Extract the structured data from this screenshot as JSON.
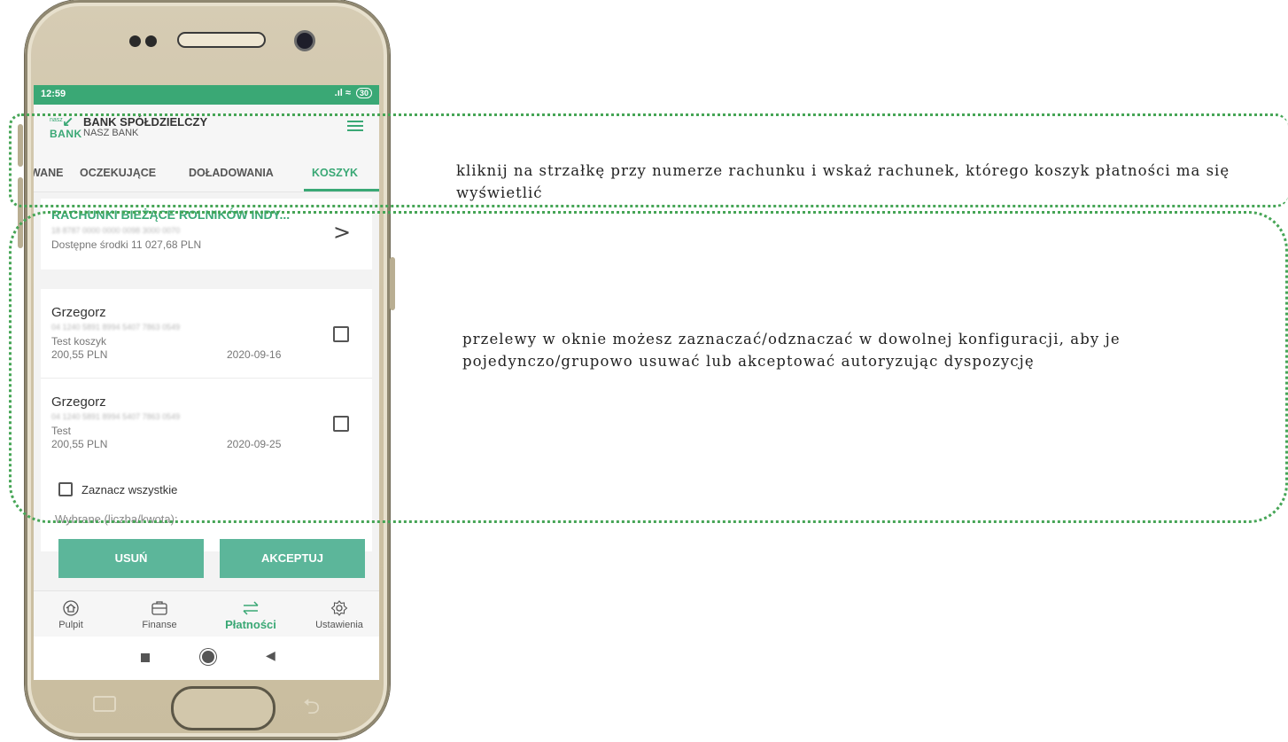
{
  "status_bar": {
    "time": "12:59",
    "battery": "30"
  },
  "header": {
    "logo_small": "nasz",
    "logo_text": "BANK",
    "bank_name": "BANK SPÓŁDZIELCZY",
    "bank_sub": "NASZ BANK"
  },
  "tabs": [
    {
      "label": "WANE"
    },
    {
      "label": "OCZEKUJĄCE"
    },
    {
      "label": "DOŁADOWANIA"
    },
    {
      "label": "KOSZYK",
      "active": true
    }
  ],
  "account": {
    "title": "RACHUNKI BIEŻĄCE ROLNIKÓW INDY...",
    "number": "18 8787 0000 0000 0098 3000 0070",
    "funds": "Dostępne środki 11 027,68 PLN"
  },
  "transfers": [
    {
      "name": "Grzegorz",
      "account": "04 1240 5891 8994 5407 7863 0549",
      "title": "Test koszyk",
      "amount": "200,55 PLN",
      "date": "2020-09-16"
    },
    {
      "name": "Grzegorz",
      "account": "04 1240 5891 8994 5407 7863 0549",
      "title": "Test",
      "amount": "200,55 PLN",
      "date": "2020-09-25"
    }
  ],
  "select_all": {
    "label": "Zaznacz wszystkie",
    "selected_label": "Wybrane (liczba/kwota):"
  },
  "buttons": {
    "delete": "USUŃ",
    "accept": "AKCEPTUJ"
  },
  "bottom_nav": [
    {
      "label": "Pulpit",
      "icon": "home-icon"
    },
    {
      "label": "Finanse",
      "icon": "wallet-icon"
    },
    {
      "label": "Płatności",
      "icon": "transfer-arrows-icon",
      "active": true
    },
    {
      "label": "Ustawienia",
      "icon": "gear-icon"
    }
  ],
  "annotations": {
    "note_1": "kliknij na strzałkę przy numerze rachunku i wskaż rachunek, którego koszyk płatności ma się wyświetlić",
    "note_2": "przelewy w oknie możesz zaznaczać/odznaczać w dowolnej konfiguracji, aby je pojedynczo/grupowo usuwać lub akceptować autoryzując dyspozycję"
  },
  "colors": {
    "accent": "#3aa875",
    "button": "#5cb69a",
    "frame": "#46a556"
  }
}
